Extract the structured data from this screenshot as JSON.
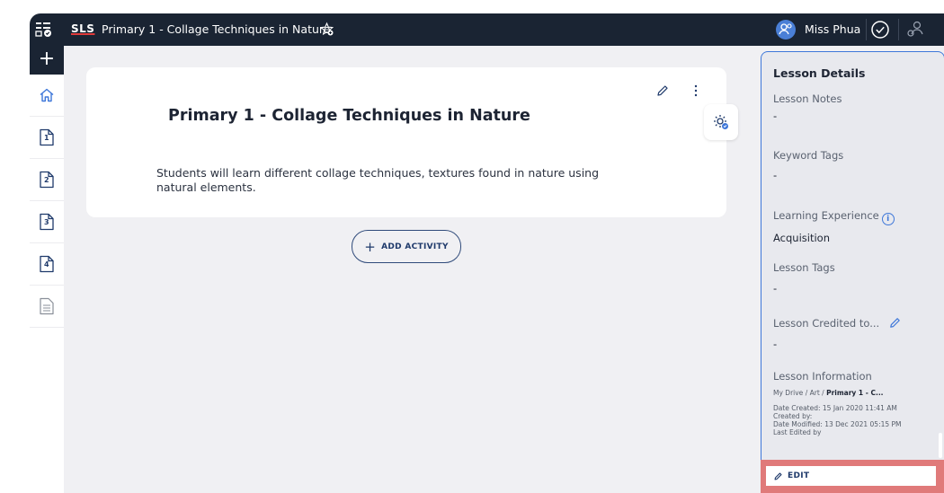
{
  "topbar": {
    "logo": "SLS",
    "title": "Primary 1 - Collage Techniques in Nature",
    "user_name": "Miss Phua"
  },
  "sidebar": {
    "add_label": "+",
    "items": [
      {
        "name": "home",
        "label": ""
      },
      {
        "name": "page-1",
        "label": "1"
      },
      {
        "name": "page-2",
        "label": "2"
      },
      {
        "name": "page-3",
        "label": "3"
      },
      {
        "name": "page-4",
        "label": "4"
      },
      {
        "name": "notes",
        "label": ""
      }
    ]
  },
  "lesson": {
    "title": "Primary 1 - Collage Techniques in Nature",
    "description": "Students will learn different collage techniques, textures found in nature using natural elements."
  },
  "add_activity_label": "ADD ACTIVITY",
  "details": {
    "heading": "Lesson Details",
    "notes_label": "Lesson Notes",
    "notes_value": "-",
    "keyword_label": "Keyword Tags",
    "keyword_value": "-",
    "experience_label": "Learning Experience",
    "experience_value": "Acquisition",
    "tags_label": "Lesson Tags",
    "tags_value": "-",
    "credited_label": "Lesson Credited to...",
    "credited_value": "-",
    "info_label": "Lesson Information",
    "crumb_1": "My Drive",
    "crumb_2": "Art",
    "crumb_3": "Primary 1 - C...",
    "crumb_sep": "/",
    "date_created": "Date Created: 15 Jan 2020 11:41 AM",
    "created_by": "Created by:",
    "date_modified": "Date Modified: 13 Dec 2021 05:15 PM",
    "last_edited": "Last Edited by"
  },
  "edit_label": "EDIT",
  "colors": {
    "topbar": "#1a2433",
    "accent": "#3e77d9",
    "highlight": "#e07a7a",
    "canvas": "#f0f0f3"
  }
}
